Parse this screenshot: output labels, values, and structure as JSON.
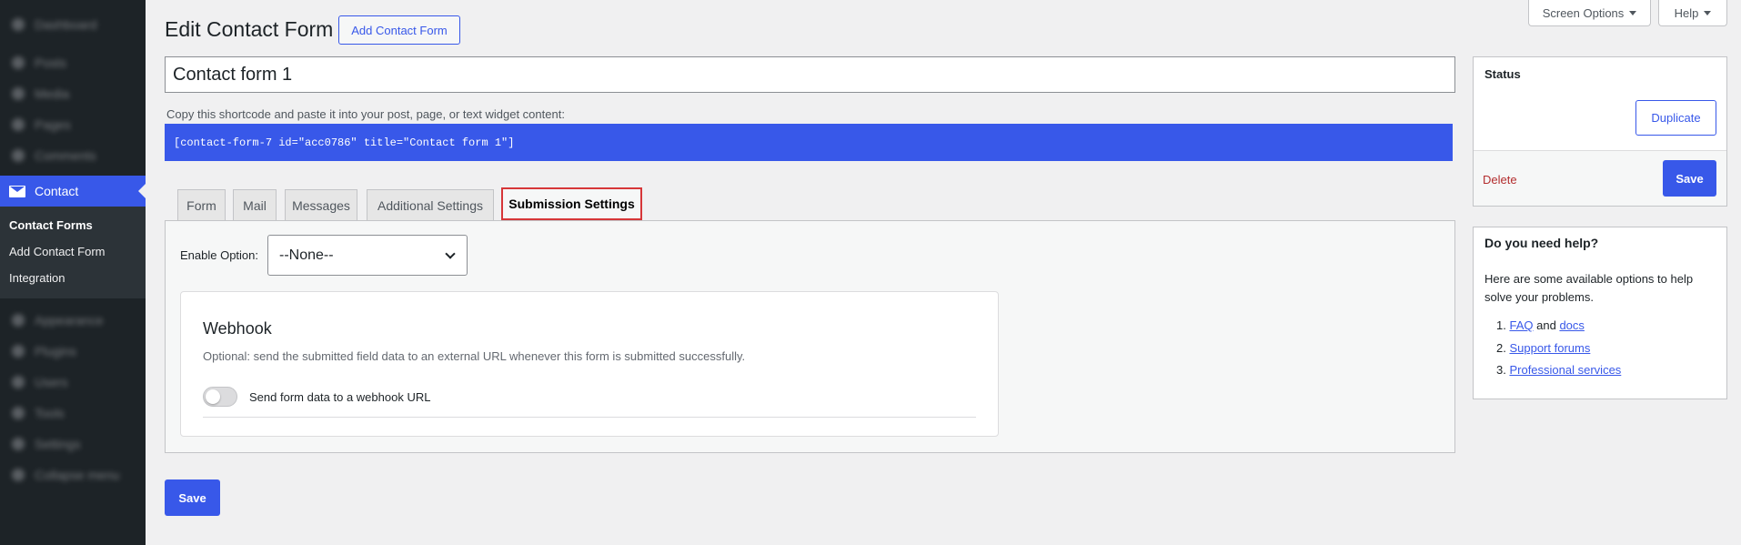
{
  "sidebar": {
    "blurred_top": [
      "Dashboard",
      "Posts",
      "Media",
      "Pages",
      "Comments"
    ],
    "active": "Contact",
    "submenu": [
      "Contact Forms",
      "Add Contact Form",
      "Integration"
    ],
    "blurred_bottom": [
      "Appearance",
      "Plugins",
      "Users",
      "Tools",
      "Settings",
      "Collapse menu"
    ]
  },
  "top": {
    "screen_options": "Screen Options",
    "help": "Help"
  },
  "header": {
    "title": "Edit Contact Form",
    "add_button": "Add Contact Form"
  },
  "form": {
    "title_value": "Contact form 1",
    "shortcode_label": "Copy this shortcode and paste it into your post, page, or text widget content:",
    "shortcode": "[contact-form-7 id=\"acc0786\" title=\"Contact form 1\"]"
  },
  "tabs": [
    "Form",
    "Mail",
    "Messages",
    "Additional Settings",
    "Submission Settings"
  ],
  "active_tab": "Submission Settings",
  "panel": {
    "enable_label": "Enable Option:",
    "enable_value": "--None--",
    "webhook_title": "Webhook",
    "webhook_desc": "Optional: send the submitted field data to an external URL whenever this form is submitted successfully.",
    "toggle_label": "Send form data to a webhook URL",
    "toggle_on": false
  },
  "save_label": "Save",
  "status_box": {
    "title": "Status",
    "duplicate": "Duplicate",
    "delete": "Delete",
    "save": "Save"
  },
  "help_box": {
    "title": "Do you need help?",
    "body": "Here are some available options to help solve your problems.",
    "item1_a": "FAQ",
    "item1_and": "and",
    "item1_b": "docs",
    "item2": "Support forums",
    "item3": "Professional services"
  },
  "colors": {
    "accent": "#3858e9",
    "sidebar": "#1d2327",
    "highlight_border": "#d63638",
    "delete": "#b32d2e"
  }
}
